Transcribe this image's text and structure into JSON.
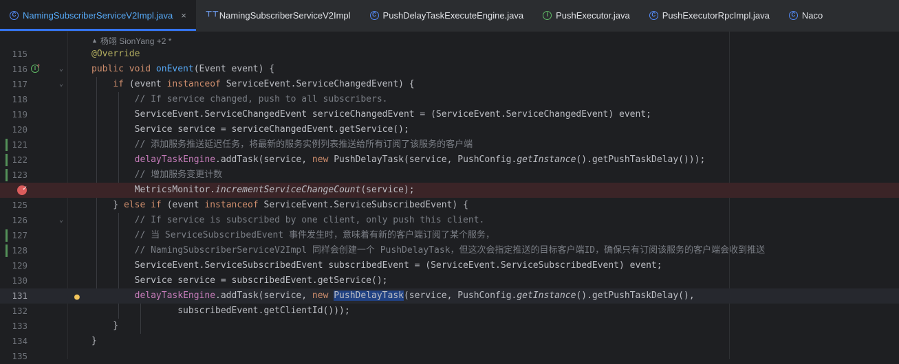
{
  "tabs": [
    {
      "label": "NamingSubscriberServiceV2Impl.java",
      "icon": "class-icon",
      "active": true,
      "closable": true
    },
    {
      "label": "NamingSubscriberServiceV2Impl",
      "icon": "test-structure-icon",
      "active": false
    },
    {
      "label": "PushDelayTaskExecuteEngine.java",
      "icon": "class-icon",
      "active": false
    },
    {
      "label": "PushExecutor.java",
      "icon": "interface-icon",
      "active": false
    },
    {
      "label": "PushExecutorRpcImpl.java",
      "icon": "class-icon",
      "active": false
    },
    {
      "label": "Naco",
      "icon": "class-icon",
      "active": false
    }
  ],
  "author_hint": "杨翊 SionYang +2 *",
  "lines": [
    {
      "n": "115",
      "t": [
        [
          "ann",
          "@Override"
        ]
      ]
    },
    {
      "n": "116",
      "t": [
        [
          "kw",
          "public void "
        ],
        [
          "fn",
          "onEvent"
        ],
        [
          "",
          "(Event event) {"
        ]
      ]
    },
    {
      "n": "117",
      "t": [
        [
          "",
          "    "
        ],
        [
          "kw",
          "if"
        ],
        [
          "",
          " (event "
        ],
        [
          "kw",
          "instanceof"
        ],
        [
          "",
          " ServiceEvent.ServiceChangedEvent) {"
        ]
      ]
    },
    {
      "n": "118",
      "t": [
        [
          "",
          "        "
        ],
        [
          "cmt",
          "// If service changed, push to all subscribers."
        ]
      ]
    },
    {
      "n": "119",
      "t": [
        [
          "",
          "        ServiceEvent.ServiceChangedEvent serviceChangedEvent = (ServiceEvent.ServiceChangedEvent) event;"
        ]
      ]
    },
    {
      "n": "120",
      "t": [
        [
          "",
          "        Service service = serviceChangedEvent.getService();"
        ]
      ]
    },
    {
      "n": "121",
      "t": [
        [
          "",
          "        "
        ],
        [
          "cmt",
          "// 添加服务推送延迟任务，将最新的服务实例列表推送给所有订阅了该服务的客户端"
        ]
      ]
    },
    {
      "n": "122",
      "t": [
        [
          "",
          "        "
        ],
        [
          "fld",
          "delayTaskEngine"
        ],
        [
          "",
          ".addTask(service, "
        ],
        [
          "kw",
          "new"
        ],
        [
          "",
          " PushDelayTask(service, PushConfig."
        ],
        [
          "ital",
          "getInstance"
        ],
        [
          "",
          "().getPushTaskDelay()));"
        ]
      ]
    },
    {
      "n": "123",
      "t": [
        [
          "",
          "        "
        ],
        [
          "cmt",
          "// 增加服务变更计数"
        ]
      ]
    },
    {
      "n": "",
      "t": [
        [
          "",
          "        MetricsMonitor."
        ],
        [
          "ital",
          "incrementServiceChangeCount"
        ],
        [
          "",
          "(service);"
        ]
      ]
    },
    {
      "n": "125",
      "t": [
        [
          "",
          "    } "
        ],
        [
          "kw",
          "else if"
        ],
        [
          "",
          " (event "
        ],
        [
          "kw",
          "instanceof"
        ],
        [
          "",
          " ServiceEvent.ServiceSubscribedEvent) {"
        ]
      ]
    },
    {
      "n": "126",
      "t": [
        [
          "",
          "        "
        ],
        [
          "cmt",
          "// If service is subscribed by one client, only push this client."
        ]
      ]
    },
    {
      "n": "127",
      "t": [
        [
          "",
          "        "
        ],
        [
          "cmt",
          "// 当 ServiceSubscribedEvent 事件发生时，意味着有新的客户端订阅了某个服务，"
        ]
      ]
    },
    {
      "n": "128",
      "t": [
        [
          "",
          "        "
        ],
        [
          "cmt",
          "// NamingSubscriberServiceV2Impl 同样会创建一个 PushDelayTask，但这次会指定推送的目标客户端ID，确保只有订阅该服务的客户端会收到推送"
        ]
      ]
    },
    {
      "n": "129",
      "t": [
        [
          "",
          "        ServiceEvent.ServiceSubscribedEvent subscribedEvent = (ServiceEvent.ServiceSubscribedEvent) event;"
        ]
      ]
    },
    {
      "n": "130",
      "t": [
        [
          "",
          "        Service service = subscribedEvent.getService();"
        ]
      ]
    },
    {
      "n": "131",
      "t": [
        [
          "",
          "        "
        ],
        [
          "fld",
          "delayTaskEngine"
        ],
        [
          "",
          ".addTask(service, "
        ],
        [
          "kw",
          "new"
        ],
        [
          "",
          " "
        ],
        [
          "sel",
          "PushDelayTask"
        ],
        [
          "",
          "(service, PushConfig."
        ],
        [
          "ital",
          "getInstance"
        ],
        [
          "",
          "().getPushTaskDelay(),"
        ]
      ]
    },
    {
      "n": "132",
      "t": [
        [
          "",
          "                subscribedEvent.getClientId()));"
        ]
      ]
    },
    {
      "n": "133",
      "t": [
        [
          "",
          "    }"
        ]
      ]
    },
    {
      "n": "134",
      "t": [
        [
          "",
          "}"
        ]
      ]
    },
    {
      "n": "135",
      "t": []
    }
  ]
}
